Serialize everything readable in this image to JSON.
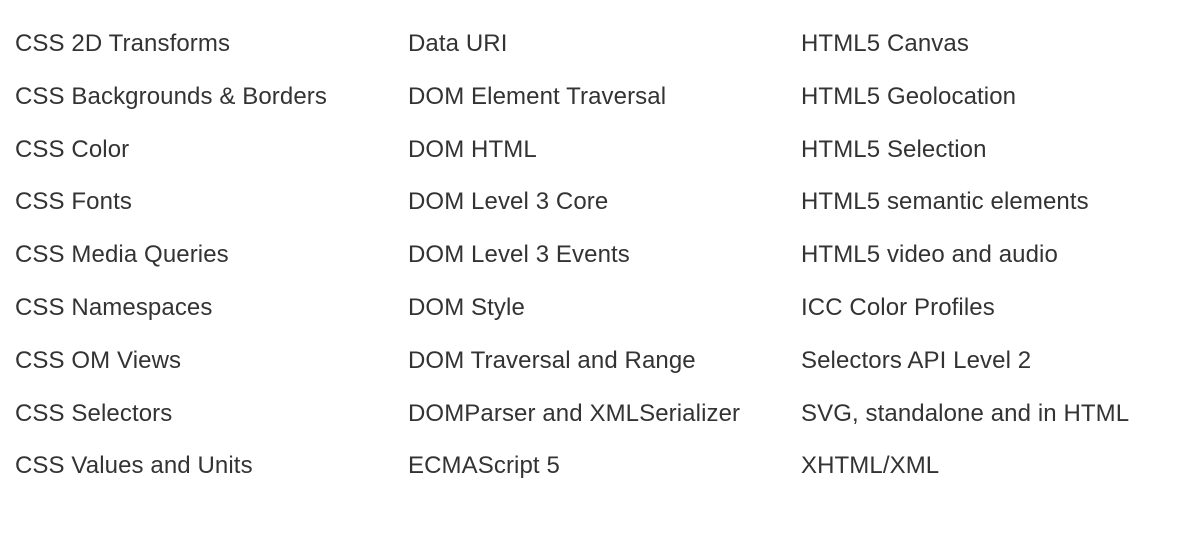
{
  "columns": [
    {
      "items": [
        "CSS 2D Transforms",
        "CSS Backgrounds & Borders",
        "CSS Color",
        "CSS Fonts",
        "CSS Media Queries",
        "CSS Namespaces",
        "CSS OM Views",
        "CSS Selectors",
        "CSS Values and Units"
      ]
    },
    {
      "items": [
        "Data URI",
        "DOM Element Traversal",
        "DOM HTML",
        "DOM Level 3 Core",
        "DOM Level 3 Events",
        "DOM Style",
        "DOM Traversal and Range",
        "DOMParser and XMLSerializer",
        "ECMAScript 5"
      ]
    },
    {
      "items": [
        "HTML5 Canvas",
        "HTML5 Geolocation",
        "HTML5 Selection",
        "HTML5 semantic elements",
        "HTML5 video and audio",
        "ICC Color Profiles",
        "Selectors API Level 2",
        "SVG, standalone and in HTML",
        "XHTML/XML"
      ]
    }
  ]
}
